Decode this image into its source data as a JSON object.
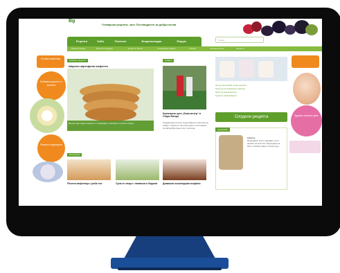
{
  "site": {
    "tagline": "Готварски рецепти, чист Пътеводител за добри ястия",
    "logo_text": "Bg"
  },
  "nav": {
    "items": [
      "Рецепти",
      "Хоби",
      "Полезно",
      "Енциклопедия",
      "Форум"
    ],
    "search_placeholder": "Търси..."
  },
  "sub_nav": {
    "items": [
      "Начин готвене",
      "Ястия по продукт",
      "Кухни по света",
      "Специални поводи",
      "Салати",
      "Сезонни ястия",
      "Напитки"
    ]
  },
  "left_ads": {
    "top_label": "Остави коментар",
    "circle_text": "Любими рецепти от кухнята",
    "bottom_label": "Рецепта седмицата"
  },
  "feature": {
    "section_tag": "Избрани рецепти",
    "title": "Шарени картофени кюфтета",
    "caption": "Вкусни картофени кюфтета с подправки и заливка от кисело мляко"
  },
  "news": {
    "section_tag": "Новини",
    "title": "Кулинарна чрез „Бяла вечер“ в Стара Загора",
    "text": "Традиционни ястия, представени в центъра на града с повече от 30 участници и състезания за най-добра рецепта от региона."
  },
  "thumbs": {
    "section_tag": "Популярни",
    "items": [
      {
        "caption": "Печени кюфтенца с риба тон"
      },
      {
        "caption": "Супа от леща с тиквички и бадеми"
      },
      {
        "caption": "Домашни шоколадови мъфини"
      }
    ]
  },
  "right_col": {
    "links": [
      "Как да приготвим лесни десерти",
      "Рецепти за празнична трапеза",
      "Идеи за бърза вечеря",
      "Кухнята на Балканите"
    ],
    "send_button": "Сподели рецепта",
    "box_tag": "Подправки",
    "box_title": "Кимион",
    "box_text": "Подправка, която придава топъл аромат на ястията. Подходяща за месо, бобови храни и зеленчуци."
  },
  "right_ad": {
    "circle_text": "Здраве за всяко дете"
  },
  "colors": {
    "brand_green": "#5e9e2b",
    "accent_orange": "#f08a1e",
    "accent_pink": "#e56ea5",
    "stand_blue": "#1b4e98"
  }
}
